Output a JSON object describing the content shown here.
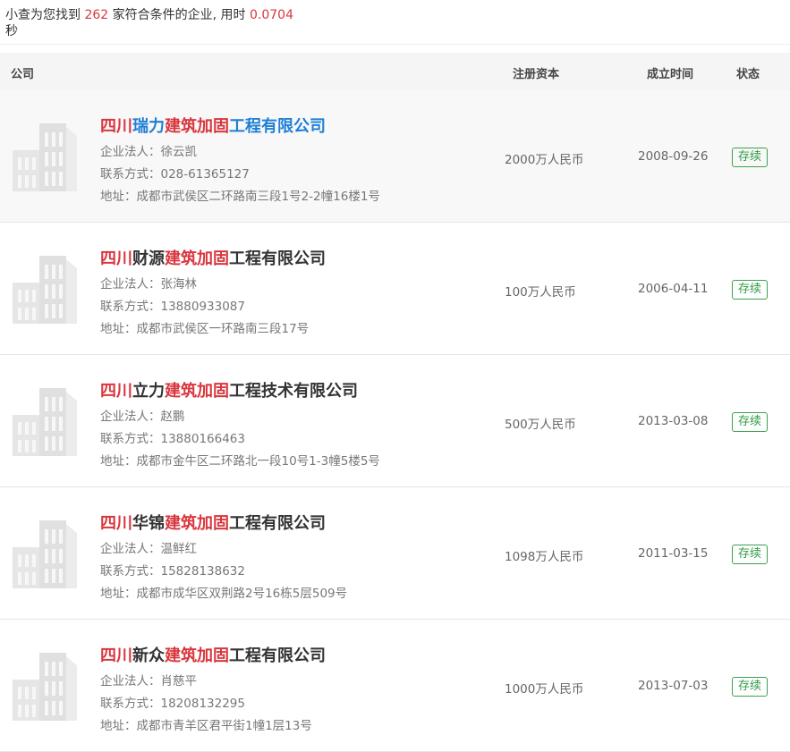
{
  "summary": {
    "prefix": "小查为您找到",
    "count": "262",
    "middle": "家符合条件的企业, 用时",
    "time": "0.0704",
    "unit": "秒"
  },
  "table_header": {
    "company": "公司",
    "capital": "注册资本",
    "founded": "成立时间",
    "status": "状态"
  },
  "rows": [
    {
      "name_parts": [
        "四川",
        "瑞力",
        "建筑加固",
        "工程有限公司"
      ],
      "legal_label": "企业法人：",
      "legal": "徐云凯",
      "contact_label": "联系方式：",
      "contact": "028-61365127",
      "address_label": "地址：",
      "address": "成都市武侯区二环路南三段1号2-2幢16楼1号",
      "capital": "2000万人民币",
      "founded": "2008-09-26",
      "status": "存续"
    },
    {
      "name_parts": [
        "四川",
        "财源",
        "建筑加固",
        "工程有限公司"
      ],
      "legal_label": "企业法人：",
      "legal": "张海林",
      "contact_label": "联系方式：",
      "contact": "13880933087",
      "address_label": "地址：",
      "address": "成都市武侯区一环路南三段17号",
      "capital": "100万人民币",
      "founded": "2006-04-11",
      "status": "存续"
    },
    {
      "name_parts": [
        "四川",
        "立力",
        "建筑加固",
        "工程技术有限公司"
      ],
      "legal_label": "企业法人：",
      "legal": "赵鹏",
      "contact_label": "联系方式：",
      "contact": "13880166463",
      "address_label": "地址：",
      "address": "成都市金牛区二环路北一段10号1-3幢5楼5号",
      "capital": "500万人民币",
      "founded": "2013-03-08",
      "status": "存续"
    },
    {
      "name_parts": [
        "四川",
        "华锦",
        "建筑加固",
        "工程有限公司"
      ],
      "legal_label": "企业法人：",
      "legal": "温鲜红",
      "contact_label": "联系方式：",
      "contact": "15828138632",
      "address_label": "地址：",
      "address": "成都市成华区双荆路2号16栋5层509号",
      "capital": "1098万人民币",
      "founded": "2011-03-15",
      "status": "存续"
    },
    {
      "name_parts": [
        "四川",
        "新众",
        "建筑加固",
        "工程有限公司"
      ],
      "legal_label": "企业法人：",
      "legal": "肖慈平",
      "contact_label": "联系方式：",
      "contact": "18208132295",
      "address_label": "地址：",
      "address": "成都市青羊区君平街1幢1层13号",
      "capital": "1000万人民币",
      "founded": "2013-07-03",
      "status": "存续"
    }
  ],
  "colors": {
    "highlight": "#d9363e",
    "hover_name": "#1e7fd6",
    "status_green": "#2e9a43"
  },
  "icons": {
    "logo": "building-icon"
  }
}
